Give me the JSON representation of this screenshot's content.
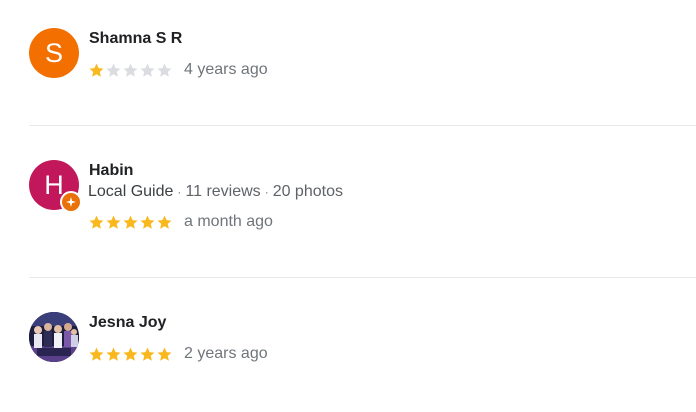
{
  "reviews": [
    {
      "author": "Shamna S R",
      "avatar_letter": "S",
      "avatar_color": "#f36f00",
      "avatar_type": "letter",
      "rating": 1,
      "max_rating": 5,
      "date": "4 years ago"
    },
    {
      "author": "Habin",
      "avatar_letter": "H",
      "avatar_color": "#c2185b",
      "avatar_type": "letter",
      "local_guide": true,
      "guide_label": "Local Guide",
      "reviews_count": "11 reviews",
      "photos_count": "20 photos",
      "separator": "·",
      "rating": 5,
      "max_rating": 5,
      "date": "a month ago"
    },
    {
      "author": "Jesna Joy",
      "avatar_type": "photo",
      "rating": 5,
      "max_rating": 5,
      "date": "2 years ago"
    }
  ],
  "colors": {
    "star_filled": "#f9b81e",
    "star_empty": "#dadce0",
    "badge": "#e8710a"
  },
  "icons": {
    "star": "star-icon",
    "badge": "local-guide-badge-icon"
  }
}
